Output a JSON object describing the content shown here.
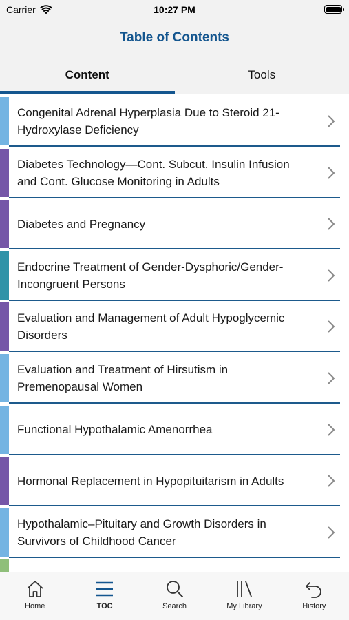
{
  "status_bar": {
    "carrier": "Carrier",
    "time": "10:27 PM"
  },
  "header": {
    "title": "Table of Contents"
  },
  "tabs": [
    {
      "label": "Content",
      "active": true
    },
    {
      "label": "Tools",
      "active": false
    }
  ],
  "colors": {
    "brand_blue": "#14568f",
    "stripe_light_blue": "#74b4e2",
    "stripe_purple": "#7557a8",
    "stripe_teal": "#2f93a8",
    "stripe_green": "#8fbf7a"
  },
  "items": [
    {
      "label": "Congenital Adrenal Hyperplasia Due to Steroid 21-Hydroxylase Deficiency",
      "stripe": "#74b4e2"
    },
    {
      "label": "Diabetes Technology—Cont. Subcut. Insulin Infusion and Cont. Glucose Monitoring in Adults",
      "stripe": "#7557a8"
    },
    {
      "label": "Diabetes and Pregnancy",
      "stripe": "#7557a8"
    },
    {
      "label": "Endocrine Treatment of Gender-Dysphoric/Gender-Incongruent Persons",
      "stripe": "#2f93a8"
    },
    {
      "label": "Evaluation and Management of Adult Hypoglycemic Disorders",
      "stripe": "#7557a8"
    },
    {
      "label": "Evaluation and Treatment of Hirsutism in Premenopausal Women",
      "stripe": "#74b4e2"
    },
    {
      "label": "Functional Hypothalamic Amenorrhea",
      "stripe": "#74b4e2"
    },
    {
      "label": "Hormonal Replacement in Hypopituitarism in Adults",
      "stripe": "#7557a8"
    },
    {
      "label": "Hypothalamic–Pituitary and Growth Disorders in Survivors of Childhood Cancer",
      "stripe": "#74b4e2"
    },
    {
      "label": "",
      "stripe": "#8fbf7a"
    }
  ],
  "tabbar": [
    {
      "label": "Home",
      "icon": "home-icon",
      "active": false
    },
    {
      "label": "TOC",
      "icon": "list-icon",
      "active": true
    },
    {
      "label": "Search",
      "icon": "search-icon",
      "active": false
    },
    {
      "label": "My Library",
      "icon": "library-icon",
      "active": false
    },
    {
      "label": "History",
      "icon": "history-icon",
      "active": false
    }
  ]
}
